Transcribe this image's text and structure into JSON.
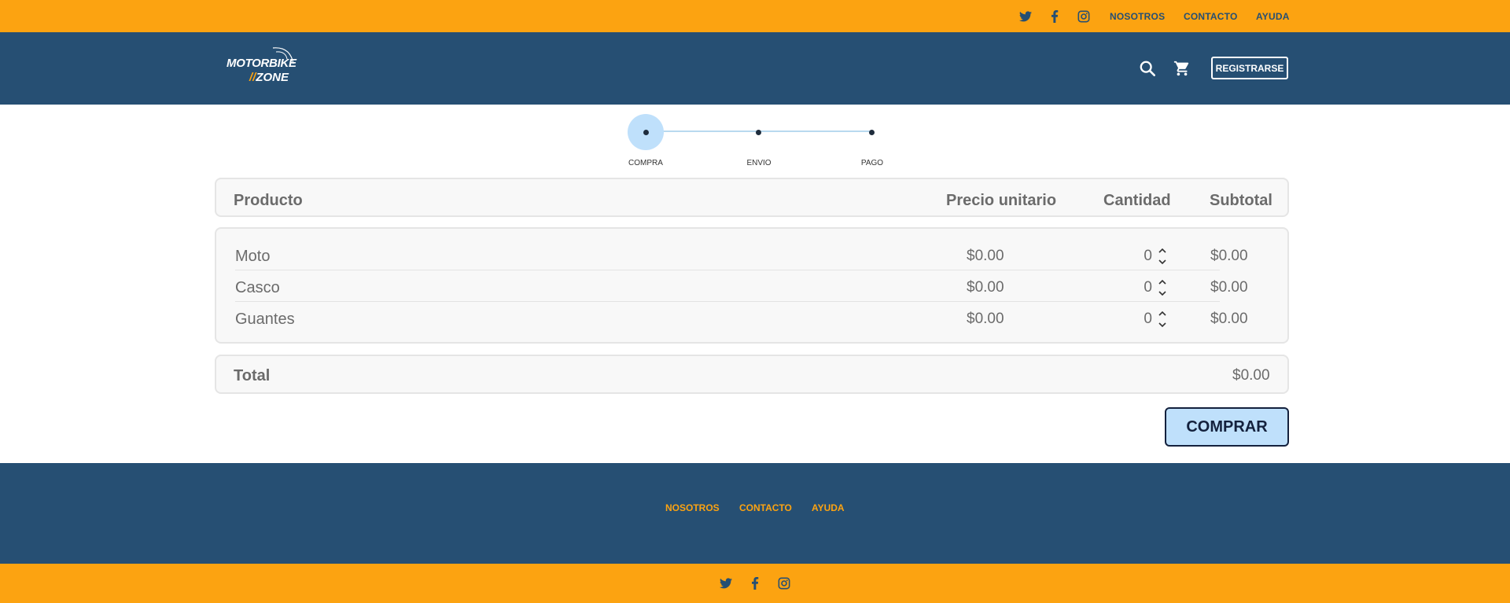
{
  "topbar": {
    "links": [
      "NOSOTROS",
      "CONTACTO",
      "AYUDA"
    ],
    "social_icons": [
      "twitter-icon",
      "facebook-icon",
      "instagram-icon"
    ]
  },
  "header": {
    "logo": {
      "line1": "MOTORBIKE",
      "line2_prefix": "//",
      "line2": "ZONE"
    },
    "icons": [
      "search-icon",
      "cart-icon"
    ],
    "register_label": "REGISTRARSE"
  },
  "stepper": {
    "steps": [
      "COMPRA",
      "ENVIO",
      "PAGO"
    ],
    "active_step": 0
  },
  "table": {
    "headers": {
      "product": "Producto",
      "unit_price": "Precio unitario",
      "quantity": "Cantidad",
      "subtotal": "Subtotal"
    },
    "rows": [
      {
        "name": "Moto",
        "price": "$0.00",
        "qty": "0",
        "subtotal": "$0.00"
      },
      {
        "name": "Casco",
        "price": "$0.00",
        "qty": "0",
        "subtotal": "$0.00"
      },
      {
        "name": "Guantes",
        "price": "$0.00",
        "qty": "0",
        "subtotal": "$0.00"
      }
    ],
    "total_label": "Total",
    "total_value": "$0.00"
  },
  "buy_label": "COMPRAR",
  "footer": {
    "links": [
      "NOSOTROS",
      "CONTACTO",
      "AYUDA"
    ]
  },
  "colors": {
    "accent": "#fca311",
    "primary": "#264f73",
    "light_blue": "#bfe0fb",
    "dark_navy": "#14213d"
  }
}
